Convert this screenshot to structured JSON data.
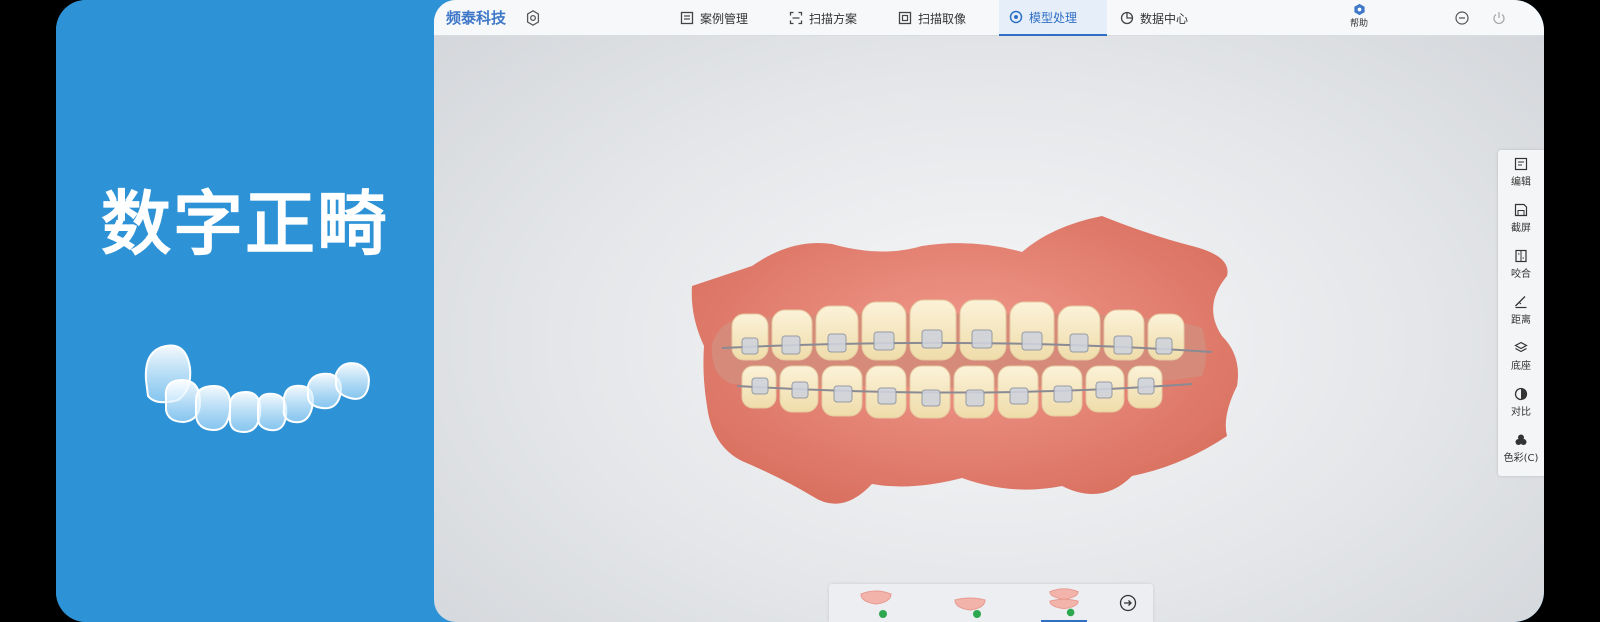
{
  "promo": {
    "title": "数字正畸"
  },
  "app": {
    "brand": "频泰科技",
    "nav": [
      {
        "label": "案例管理",
        "icon": "case-management-icon"
      },
      {
        "label": "扫描方案",
        "icon": "scan-plan-icon"
      },
      {
        "label": "扫描取像",
        "icon": "scan-capture-icon"
      },
      {
        "label": "模型处理",
        "icon": "model-processing-icon",
        "active": true
      },
      {
        "label": "数据中心",
        "icon": "data-center-icon"
      }
    ],
    "help_label": "帮助",
    "tools": [
      {
        "label": "编辑",
        "icon": "edit-icon"
      },
      {
        "label": "截屏",
        "icon": "screenshot-icon"
      },
      {
        "label": "咬合",
        "icon": "occlusion-icon"
      },
      {
        "label": "距离",
        "icon": "distance-icon"
      },
      {
        "label": "底座",
        "icon": "base-icon"
      },
      {
        "label": "对比",
        "icon": "contrast-icon"
      },
      {
        "label": "色彩(C)",
        "icon": "color-icon"
      }
    ],
    "bottom": {
      "jaws": [
        "upper-jaw",
        "lower-jaw",
        "both-jaws"
      ],
      "active_jaw": "both-jaws"
    },
    "colors": {
      "accent": "#2f6fc4",
      "promo_bg": "#2e93d6",
      "gum": "#e9867c"
    }
  }
}
